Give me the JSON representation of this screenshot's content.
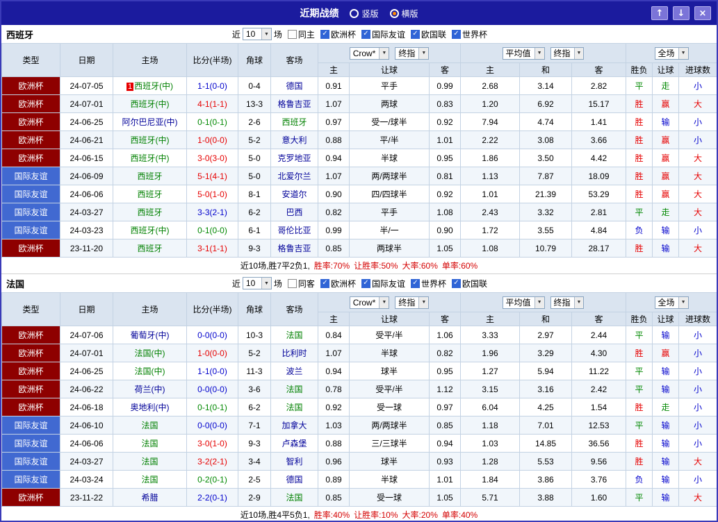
{
  "colors": {
    "page_border": "#3a3ab8",
    "titlebar_bg": "#1b1b9e",
    "type_euro": "#8e0000",
    "type_friendly": "#4169d1",
    "color_red": "#e60000",
    "color_blue": "#0000cc",
    "color_green": "#008800",
    "focus_team": "#008000",
    "opp_team": "#000099"
  },
  "titlebar": {
    "title": "近期战绩",
    "radio_vertical": "竖版",
    "radio_horizontal": "横版",
    "selected": "横版",
    "buttons": {
      "up": "↑",
      "down": "↓",
      "close": "×"
    }
  },
  "table_header": {
    "static": [
      "类型",
      "日期",
      "主场",
      "比分(半场)",
      "角球",
      "客场"
    ],
    "selects": {
      "odds_source": "Crow*",
      "odds_stage": "终指",
      "avg_source": "平均值",
      "avg_stage": "终指",
      "scope": "全场"
    },
    "sub": [
      "主",
      "让球",
      "客",
      "主",
      "和",
      "客",
      "胜负",
      "让球",
      "进球数"
    ]
  },
  "sections": [
    {
      "team": "西班牙",
      "filter": {
        "near": "近",
        "count": "10",
        "matches": "场",
        "same": "同主",
        "leagues": [
          "欧洲杯",
          "国际友谊",
          "欧国联",
          "世界杯"
        ]
      },
      "rows": [
        {
          "type": "欧洲杯",
          "date": "24-07-05",
          "badge": "1",
          "home": "西班牙(中)",
          "score": "1-1(0-0)",
          "corners": "0-4",
          "away": "德国",
          "odds": [
            "0.91",
            "平手",
            "0.99"
          ],
          "avg": [
            "2.68",
            "3.14",
            "2.82"
          ],
          "results": [
            "平",
            "走",
            "小"
          ]
        },
        {
          "type": "欧洲杯",
          "date": "24-07-01",
          "home": "西班牙(中)",
          "score": "4-1(1-1)",
          "corners": "13-3",
          "away": "格鲁吉亚",
          "odds": [
            "1.07",
            "两球",
            "0.83"
          ],
          "avg": [
            "1.20",
            "6.92",
            "15.17"
          ],
          "results": [
            "胜",
            "赢",
            "大"
          ]
        },
        {
          "type": "欧洲杯",
          "date": "24-06-25",
          "home": "阿尔巴尼亚(中)",
          "score": "0-1(0-1)",
          "corners": "2-6",
          "away": "西班牙",
          "odds": [
            "0.97",
            "受一/球半",
            "0.92"
          ],
          "avg": [
            "7.94",
            "4.74",
            "1.41"
          ],
          "results": [
            "胜",
            "输",
            "小"
          ]
        },
        {
          "type": "欧洲杯",
          "date": "24-06-21",
          "home": "西班牙(中)",
          "score": "1-0(0-0)",
          "corners": "5-2",
          "away": "意大利",
          "odds": [
            "0.88",
            "平/半",
            "1.01"
          ],
          "avg": [
            "2.22",
            "3.08",
            "3.66"
          ],
          "results": [
            "胜",
            "赢",
            "小"
          ]
        },
        {
          "type": "欧洲杯",
          "date": "24-06-15",
          "home": "西班牙(中)",
          "score": "3-0(3-0)",
          "corners": "5-0",
          "away": "克罗地亚",
          "odds": [
            "0.94",
            "半球",
            "0.95"
          ],
          "avg": [
            "1.86",
            "3.50",
            "4.42"
          ],
          "results": [
            "胜",
            "赢",
            "大"
          ]
        },
        {
          "type": "国际友谊",
          "date": "24-06-09",
          "home": "西班牙",
          "score": "5-1(4-1)",
          "corners": "5-0",
          "away": "北爱尔兰",
          "odds": [
            "1.07",
            "两/两球半",
            "0.81"
          ],
          "avg": [
            "1.13",
            "7.87",
            "18.09"
          ],
          "results": [
            "胜",
            "赢",
            "大"
          ]
        },
        {
          "type": "国际友谊",
          "date": "24-06-06",
          "home": "西班牙",
          "score": "5-0(1-0)",
          "corners": "8-1",
          "away": "安道尔",
          "odds": [
            "0.90",
            "四/四球半",
            "0.92"
          ],
          "avg": [
            "1.01",
            "21.39",
            "53.29"
          ],
          "results": [
            "胜",
            "赢",
            "大"
          ]
        },
        {
          "type": "国际友谊",
          "date": "24-03-27",
          "home": "西班牙",
          "score": "3-3(2-1)",
          "corners": "6-2",
          "away": "巴西",
          "odds": [
            "0.82",
            "平手",
            "1.08"
          ],
          "avg": [
            "2.43",
            "3.32",
            "2.81"
          ],
          "results": [
            "平",
            "走",
            "大"
          ]
        },
        {
          "type": "国际友谊",
          "date": "24-03-23",
          "home": "西班牙(中)",
          "score": "0-1(0-0)",
          "corners": "6-1",
          "away": "哥伦比亚",
          "odds": [
            "0.99",
            "半/一",
            "0.90"
          ],
          "avg": [
            "1.72",
            "3.55",
            "4.84"
          ],
          "results": [
            "负",
            "输",
            "小"
          ]
        },
        {
          "type": "欧洲杯",
          "date": "23-11-20",
          "home": "西班牙",
          "score": "3-1(1-1)",
          "corners": "9-3",
          "away": "格鲁吉亚",
          "odds": [
            "0.85",
            "两球半",
            "1.05"
          ],
          "avg": [
            "1.08",
            "10.79",
            "28.17"
          ],
          "results": [
            "胜",
            "输",
            "大"
          ]
        }
      ],
      "summary": {
        "prefix": "近10场,胜7平2负1,",
        "stats": [
          "胜率:70%",
          "让胜率:50%",
          "大率:60%",
          "单率:60%"
        ]
      }
    },
    {
      "team": "法国",
      "filter": {
        "near": "近",
        "count": "10",
        "matches": "场",
        "same": "同客",
        "leagues": [
          "欧洲杯",
          "国际友谊",
          "世界杯",
          "欧国联"
        ]
      },
      "rows": [
        {
          "type": "欧洲杯",
          "date": "24-07-06",
          "home": "葡萄牙(中)",
          "score": "0-0(0-0)",
          "corners": "10-3",
          "away": "法国",
          "odds": [
            "0.84",
            "受平/半",
            "1.06"
          ],
          "avg": [
            "3.33",
            "2.97",
            "2.44"
          ],
          "results": [
            "平",
            "输",
            "小"
          ]
        },
        {
          "type": "欧洲杯",
          "date": "24-07-01",
          "home": "法国(中)",
          "score": "1-0(0-0)",
          "corners": "5-2",
          "away": "比利时",
          "odds": [
            "1.07",
            "半球",
            "0.82"
          ],
          "avg": [
            "1.96",
            "3.29",
            "4.30"
          ],
          "results": [
            "胜",
            "赢",
            "小"
          ]
        },
        {
          "type": "欧洲杯",
          "date": "24-06-25",
          "home": "法国(中)",
          "score": "1-1(0-0)",
          "corners": "11-3",
          "away": "波兰",
          "odds": [
            "0.94",
            "球半",
            "0.95"
          ],
          "avg": [
            "1.27",
            "5.94",
            "11.22"
          ],
          "results": [
            "平",
            "输",
            "小"
          ]
        },
        {
          "type": "欧洲杯",
          "date": "24-06-22",
          "home": "荷兰(中)",
          "score": "0-0(0-0)",
          "corners": "3-6",
          "away": "法国",
          "odds": [
            "0.78",
            "受平/半",
            "1.12"
          ],
          "avg": [
            "3.15",
            "3.16",
            "2.42"
          ],
          "results": [
            "平",
            "输",
            "小"
          ]
        },
        {
          "type": "欧洲杯",
          "date": "24-06-18",
          "home": "奥地利(中)",
          "score": "0-1(0-1)",
          "corners": "6-2",
          "away": "法国",
          "odds": [
            "0.92",
            "受一球",
            "0.97"
          ],
          "avg": [
            "6.04",
            "4.25",
            "1.54"
          ],
          "results": [
            "胜",
            "走",
            "小"
          ]
        },
        {
          "type": "国际友谊",
          "date": "24-06-10",
          "home": "法国",
          "score": "0-0(0-0)",
          "corners": "7-1",
          "away": "加拿大",
          "odds": [
            "1.03",
            "两/两球半",
            "0.85"
          ],
          "avg": [
            "1.18",
            "7.01",
            "12.53"
          ],
          "results": [
            "平",
            "输",
            "小"
          ]
        },
        {
          "type": "国际友谊",
          "date": "24-06-06",
          "home": "法国",
          "score": "3-0(1-0)",
          "corners": "9-3",
          "away": "卢森堡",
          "odds": [
            "0.88",
            "三/三球半",
            "0.94"
          ],
          "avg": [
            "1.03",
            "14.85",
            "36.56"
          ],
          "results": [
            "胜",
            "输",
            "小"
          ]
        },
        {
          "type": "国际友谊",
          "date": "24-03-27",
          "home": "法国",
          "score": "3-2(2-1)",
          "corners": "3-4",
          "away": "智利",
          "odds": [
            "0.96",
            "球半",
            "0.93"
          ],
          "avg": [
            "1.28",
            "5.53",
            "9.56"
          ],
          "results": [
            "胜",
            "输",
            "大"
          ]
        },
        {
          "type": "国际友谊",
          "date": "24-03-24",
          "home": "法国",
          "score": "0-2(0-1)",
          "corners": "2-5",
          "away": "德国",
          "odds": [
            "0.89",
            "半球",
            "1.01"
          ],
          "avg": [
            "1.84",
            "3.86",
            "3.76"
          ],
          "results": [
            "负",
            "输",
            "小"
          ]
        },
        {
          "type": "欧洲杯",
          "date": "23-11-22",
          "home": "希腊",
          "score": "2-2(0-1)",
          "corners": "2-9",
          "away": "法国",
          "odds": [
            "0.85",
            "受一球",
            "1.05"
          ],
          "avg": [
            "5.71",
            "3.88",
            "1.60"
          ],
          "results": [
            "平",
            "输",
            "大"
          ]
        }
      ],
      "summary": {
        "prefix": "近10场,胜4平5负1,",
        "stats": [
          "胜率:40%",
          "让胜率:10%",
          "大率:20%",
          "单率:40%"
        ]
      }
    }
  ]
}
